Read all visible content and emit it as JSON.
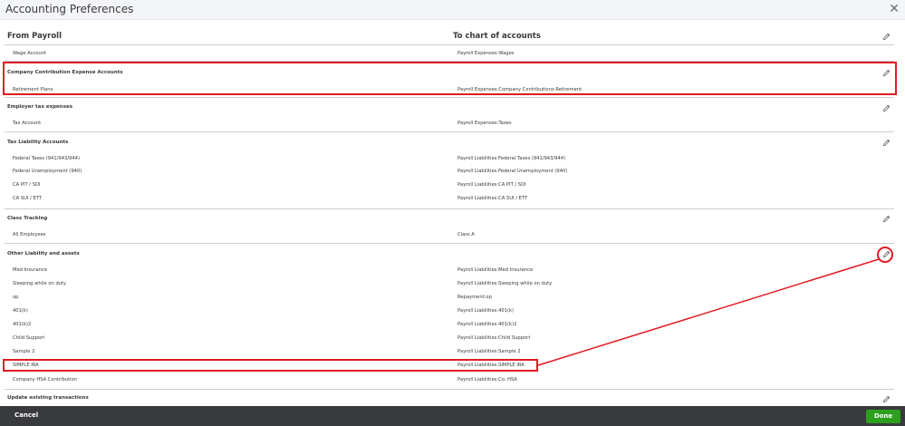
{
  "dialog": {
    "title": "Accounting Preferences"
  },
  "headers": {
    "from": "From Payroll",
    "to": "To chart of accounts"
  },
  "rows": [
    {
      "from": "Wage Account",
      "to": "Payroll Expenses:Wages"
    }
  ],
  "sections": [
    {
      "title": "Company Contribution Expense Accounts",
      "items": [
        {
          "from": "Retirement Plans",
          "to": "Payroll Expenses:Company Contributions:Retirement"
        }
      ]
    },
    {
      "title": "Employer tax expenses",
      "items": [
        {
          "from": "Tax Account",
          "to": "Payroll Expenses:Taxes"
        }
      ]
    },
    {
      "title": "Tax Liability Accounts",
      "items": [
        {
          "from": "Federal Taxes (941/943/944)",
          "to": "Payroll Liabilities:Federal Taxes (941/943/944)"
        },
        {
          "from": "Federal Unemployment (940)",
          "to": "Payroll Liabilities:Federal Unemployment (940)"
        },
        {
          "from": "CA PIT / SDI",
          "to": "Payroll Liabilities:CA PIT / SDI"
        },
        {
          "from": "CA SUI / ETT",
          "to": "Payroll Liabilities:CA SUI / ETT"
        }
      ]
    },
    {
      "title": "Class Tracking",
      "items": [
        {
          "from": "All Employees",
          "to": "Class A"
        }
      ]
    },
    {
      "title": "Other Liability and assets",
      "items": [
        {
          "from": "Med Insurance",
          "to": "Payroll Liabilities:Med Insurance"
        },
        {
          "from": "Sleeping while on duty",
          "to": "Payroll Liabilities:Sleeping while on duty"
        },
        {
          "from": "op",
          "to": "Repayment:op"
        },
        {
          "from": "401(k)",
          "to": "Payroll Liabilities:401(k)"
        },
        {
          "from": "401(k)2",
          "to": "Payroll Liabilities:401(k)2"
        },
        {
          "from": "Child Support",
          "to": "Payroll Liabilities:Child Support"
        },
        {
          "from": "Sample 2",
          "to": "Payroll Liabilities:Sample 2"
        },
        {
          "from": "SIMPLE IRA",
          "to": "Payroll Liabilities:SIMPLE IRA"
        },
        {
          "from": "Company HSA Contribution",
          "to": "Payroll Liabilities:Co. HSA"
        }
      ]
    },
    {
      "title": "Update existing transactions",
      "items": []
    }
  ],
  "footer": {
    "cancel": "Cancel",
    "done": "Done"
  },
  "icons": {
    "close": "close-icon",
    "edit": "pencil-icon"
  },
  "colors": {
    "highlight": "#e01b24",
    "done": "#2ca01c",
    "footer": "#393a3d"
  }
}
